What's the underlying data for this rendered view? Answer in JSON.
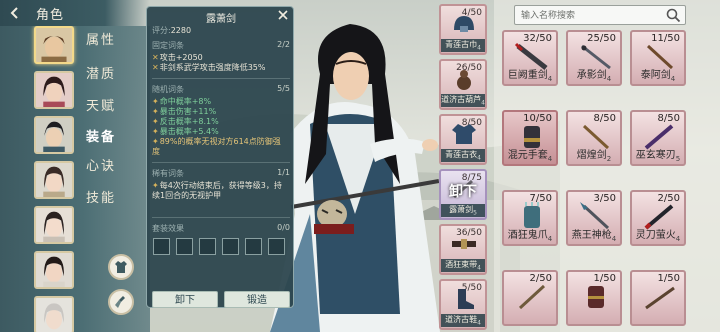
{
  "header": {
    "title": "角色"
  },
  "nav": {
    "items": [
      "属性",
      "潜质",
      "天赋",
      "装备",
      "心诀",
      "技能"
    ],
    "active": "装备"
  },
  "tooltip": {
    "title": "露萧剑",
    "score_label": "评分:",
    "score": "2280",
    "fixed_label": "固定词条",
    "fixed_count": "2/2",
    "fixed_lines": [
      "攻击+2050",
      "非剑系武学攻击强度降低35%"
    ],
    "random_label": "随机词条",
    "random_count": "5/5",
    "random_lines": [
      "命中概率+8%",
      "暴击伤害+11%",
      "反击概率+8.1%",
      "暴击概率+5.4%"
    ],
    "random_special_1": "89%的概率无视对方614点防御强",
    "random_special_2": "度",
    "rare_label": "稀有词条",
    "rare_count": "1/1",
    "rare_line_1": "每4次行动结束后，获得等级3，持",
    "rare_line_2": "续1回合的无视护甲",
    "set_label": "套装效果",
    "set_count": "0/0",
    "btn_unequip": "卸下",
    "btn_forge": "锻造"
  },
  "equipped": [
    {
      "count": "4/50",
      "name": "青莲古巾",
      "level": "4",
      "type": "helmet"
    },
    {
      "count": "26/50",
      "name": "道济古葫芦",
      "level": "4",
      "type": "gourd"
    },
    {
      "count": "8/50",
      "name": "青莲古衣",
      "level": "4",
      "type": "robe"
    },
    {
      "count": "8/75",
      "name": "露萧剑",
      "level": "5",
      "type": "sword",
      "overlay": "卸下"
    },
    {
      "count": "36/50",
      "name": "酒狂束带",
      "level": "4",
      "type": "belt"
    },
    {
      "count": "5/50",
      "name": "道济古鞋",
      "level": "4",
      "type": "boots"
    }
  ],
  "search": {
    "placeholder": "输入名称搜索"
  },
  "inventory": [
    {
      "count": "32/50",
      "name": "巨阙重剑",
      "level": "4",
      "type": "sword"
    },
    {
      "count": "25/50",
      "name": "承影剑",
      "level": "4",
      "type": "sword2"
    },
    {
      "count": "11/50",
      "name": "泰阿剑",
      "level": "4",
      "type": "staff"
    },
    {
      "count": "10/50",
      "name": "混元手套",
      "level": "4",
      "type": "glove"
    },
    {
      "count": "8/50",
      "name": "熠煌剑",
      "level": "2",
      "type": "staff"
    },
    {
      "count": "8/50",
      "name": "巫玄寒刃",
      "level": "5",
      "type": "blade"
    },
    {
      "count": "7/50",
      "name": "酒狂鬼爪",
      "level": "4",
      "type": "glove"
    },
    {
      "count": "3/50",
      "name": "燕王神枪",
      "level": "4",
      "type": "spear"
    },
    {
      "count": "2/50",
      "name": "灵刀萤火",
      "level": "4",
      "type": "blade"
    },
    {
      "count": "2/50",
      "name": "",
      "level": "",
      "type": "staff"
    },
    {
      "count": "1/50",
      "name": "",
      "level": "",
      "type": "glove"
    },
    {
      "count": "1/50",
      "name": "",
      "level": "",
      "type": "staff"
    }
  ]
}
